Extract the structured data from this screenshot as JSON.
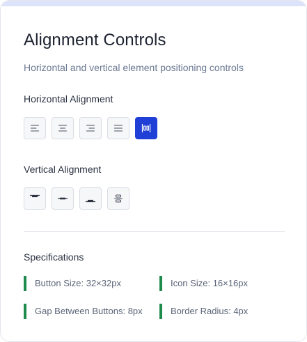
{
  "header": {
    "title": "Alignment Controls",
    "subtitle": "Horizontal and vertical element positioning controls"
  },
  "horizontal": {
    "label": "Horizontal Alignment",
    "buttons": [
      {
        "icon": "align-left-icon",
        "active": false
      },
      {
        "icon": "align-center-icon",
        "active": false
      },
      {
        "icon": "align-right-icon",
        "active": false
      },
      {
        "icon": "align-justify-icon",
        "active": false
      },
      {
        "icon": "distribute-horizontal-icon",
        "active": true
      }
    ]
  },
  "vertical": {
    "label": "Vertical Alignment",
    "buttons": [
      {
        "icon": "align-top-icon",
        "active": false
      },
      {
        "icon": "align-middle-icon",
        "active": false
      },
      {
        "icon": "align-bottom-icon",
        "active": false
      },
      {
        "icon": "distribute-vertical-icon",
        "active": false
      }
    ]
  },
  "specs": {
    "label": "Specifications",
    "items": [
      "Button Size: 32×32px",
      "Icon Size: 16×16px",
      "Gap Between Buttons: 8px",
      "Border Radius: 4px"
    ]
  },
  "colors": {
    "accent": "#1f3fd6",
    "spec_marker": "#1e8a4c",
    "top_bar": "#dde3fb"
  }
}
